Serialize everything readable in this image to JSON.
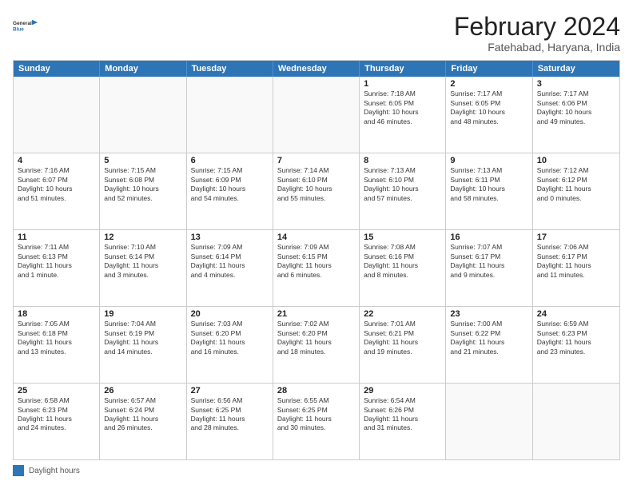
{
  "logo": {
    "line1": "General",
    "line2": "Blue"
  },
  "title": "February 2024",
  "subtitle": "Fatehabad, Haryana, India",
  "days_of_week": [
    "Sunday",
    "Monday",
    "Tuesday",
    "Wednesday",
    "Thursday",
    "Friday",
    "Saturday"
  ],
  "weeks": [
    [
      {
        "num": "",
        "info": ""
      },
      {
        "num": "",
        "info": ""
      },
      {
        "num": "",
        "info": ""
      },
      {
        "num": "",
        "info": ""
      },
      {
        "num": "1",
        "info": "Sunrise: 7:18 AM\nSunset: 6:05 PM\nDaylight: 10 hours\nand 46 minutes."
      },
      {
        "num": "2",
        "info": "Sunrise: 7:17 AM\nSunset: 6:05 PM\nDaylight: 10 hours\nand 48 minutes."
      },
      {
        "num": "3",
        "info": "Sunrise: 7:17 AM\nSunset: 6:06 PM\nDaylight: 10 hours\nand 49 minutes."
      }
    ],
    [
      {
        "num": "4",
        "info": "Sunrise: 7:16 AM\nSunset: 6:07 PM\nDaylight: 10 hours\nand 51 minutes."
      },
      {
        "num": "5",
        "info": "Sunrise: 7:15 AM\nSunset: 6:08 PM\nDaylight: 10 hours\nand 52 minutes."
      },
      {
        "num": "6",
        "info": "Sunrise: 7:15 AM\nSunset: 6:09 PM\nDaylight: 10 hours\nand 54 minutes."
      },
      {
        "num": "7",
        "info": "Sunrise: 7:14 AM\nSunset: 6:10 PM\nDaylight: 10 hours\nand 55 minutes."
      },
      {
        "num": "8",
        "info": "Sunrise: 7:13 AM\nSunset: 6:10 PM\nDaylight: 10 hours\nand 57 minutes."
      },
      {
        "num": "9",
        "info": "Sunrise: 7:13 AM\nSunset: 6:11 PM\nDaylight: 10 hours\nand 58 minutes."
      },
      {
        "num": "10",
        "info": "Sunrise: 7:12 AM\nSunset: 6:12 PM\nDaylight: 11 hours\nand 0 minutes."
      }
    ],
    [
      {
        "num": "11",
        "info": "Sunrise: 7:11 AM\nSunset: 6:13 PM\nDaylight: 11 hours\nand 1 minute."
      },
      {
        "num": "12",
        "info": "Sunrise: 7:10 AM\nSunset: 6:14 PM\nDaylight: 11 hours\nand 3 minutes."
      },
      {
        "num": "13",
        "info": "Sunrise: 7:09 AM\nSunset: 6:14 PM\nDaylight: 11 hours\nand 4 minutes."
      },
      {
        "num": "14",
        "info": "Sunrise: 7:09 AM\nSunset: 6:15 PM\nDaylight: 11 hours\nand 6 minutes."
      },
      {
        "num": "15",
        "info": "Sunrise: 7:08 AM\nSunset: 6:16 PM\nDaylight: 11 hours\nand 8 minutes."
      },
      {
        "num": "16",
        "info": "Sunrise: 7:07 AM\nSunset: 6:17 PM\nDaylight: 11 hours\nand 9 minutes."
      },
      {
        "num": "17",
        "info": "Sunrise: 7:06 AM\nSunset: 6:17 PM\nDaylight: 11 hours\nand 11 minutes."
      }
    ],
    [
      {
        "num": "18",
        "info": "Sunrise: 7:05 AM\nSunset: 6:18 PM\nDaylight: 11 hours\nand 13 minutes."
      },
      {
        "num": "19",
        "info": "Sunrise: 7:04 AM\nSunset: 6:19 PM\nDaylight: 11 hours\nand 14 minutes."
      },
      {
        "num": "20",
        "info": "Sunrise: 7:03 AM\nSunset: 6:20 PM\nDaylight: 11 hours\nand 16 minutes."
      },
      {
        "num": "21",
        "info": "Sunrise: 7:02 AM\nSunset: 6:20 PM\nDaylight: 11 hours\nand 18 minutes."
      },
      {
        "num": "22",
        "info": "Sunrise: 7:01 AM\nSunset: 6:21 PM\nDaylight: 11 hours\nand 19 minutes."
      },
      {
        "num": "23",
        "info": "Sunrise: 7:00 AM\nSunset: 6:22 PM\nDaylight: 11 hours\nand 21 minutes."
      },
      {
        "num": "24",
        "info": "Sunrise: 6:59 AM\nSunset: 6:23 PM\nDaylight: 11 hours\nand 23 minutes."
      }
    ],
    [
      {
        "num": "25",
        "info": "Sunrise: 6:58 AM\nSunset: 6:23 PM\nDaylight: 11 hours\nand 24 minutes."
      },
      {
        "num": "26",
        "info": "Sunrise: 6:57 AM\nSunset: 6:24 PM\nDaylight: 11 hours\nand 26 minutes."
      },
      {
        "num": "27",
        "info": "Sunrise: 6:56 AM\nSunset: 6:25 PM\nDaylight: 11 hours\nand 28 minutes."
      },
      {
        "num": "28",
        "info": "Sunrise: 6:55 AM\nSunset: 6:25 PM\nDaylight: 11 hours\nand 30 minutes."
      },
      {
        "num": "29",
        "info": "Sunrise: 6:54 AM\nSunset: 6:26 PM\nDaylight: 11 hours\nand 31 minutes."
      },
      {
        "num": "",
        "info": ""
      },
      {
        "num": "",
        "info": ""
      }
    ]
  ],
  "footer": {
    "legend_label": "Daylight hours"
  }
}
